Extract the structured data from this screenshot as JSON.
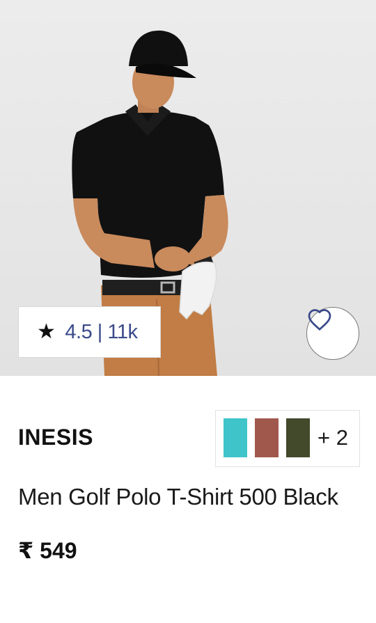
{
  "product": {
    "rating_star": "★",
    "rating_text": "4.5 | 11k",
    "brand": "INESIS",
    "title": "Men Golf Polo T-Shirt 500 Black",
    "price": "₹ 549",
    "image_alt": "Model wearing black golf polo t-shirt with cap, brown trousers and white golf glove"
  },
  "colors": {
    "swatches": [
      "#3fc5c9",
      "#a0584c",
      "#434a2c"
    ],
    "more": "+ 2"
  },
  "icons": {
    "wishlist": "heart-outline-icon",
    "rating": "star-icon"
  }
}
